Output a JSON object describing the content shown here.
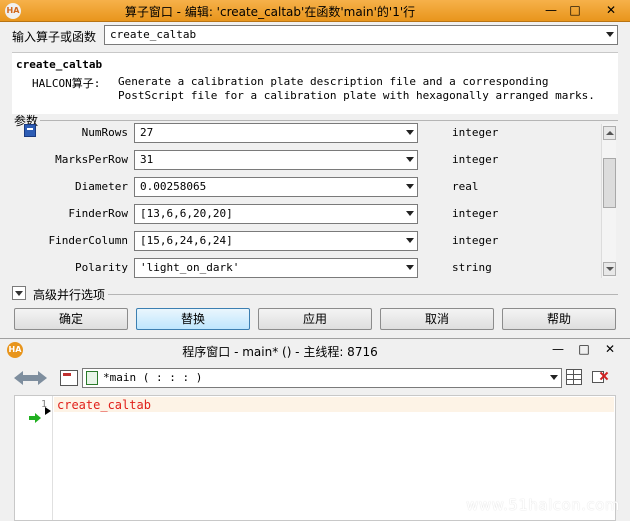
{
  "operator_window": {
    "title": "算子窗口 - 编辑: 'create_caltab'在函数'main'的'1'行",
    "input_label": "输入算子或函数",
    "input_value": "create_caltab",
    "desc": {
      "name": "create_caltab",
      "label": "HALCON算子:",
      "text": "Generate a calibration plate description file and a corresponding PostScript file for a calibration plate with hexagonally arranged marks."
    },
    "params_header": "参数",
    "params": [
      {
        "name": "NumRows",
        "value": "27",
        "type": "integer"
      },
      {
        "name": "MarksPerRow",
        "value": "31",
        "type": "integer"
      },
      {
        "name": "Diameter",
        "value": "0.00258065",
        "type": "real"
      },
      {
        "name": "FinderRow",
        "value": "[13,6,6,20,20]",
        "type": "integer"
      },
      {
        "name": "FinderColumn",
        "value": "[15,6,24,6,24]",
        "type": "integer"
      },
      {
        "name": "Polarity",
        "value": "'light_on_dark'",
        "type": "string"
      }
    ],
    "advanced_label": "高级并行选项",
    "buttons": {
      "ok": "确定",
      "replace": "替换",
      "apply": "应用",
      "cancel": "取消",
      "help": "帮助"
    },
    "window_controls": {
      "minimize": "—",
      "maximize": "□",
      "close": "✕"
    }
  },
  "program_window": {
    "title": "程序窗口 - main* () - 主线程: 8716",
    "procedure_select": "*main ( : : : )",
    "line_number": "1",
    "code_line": "create_caltab",
    "window_controls": {
      "minimize": "—",
      "maximize": "□",
      "close": "✕"
    }
  },
  "app_icon_text": "HA",
  "watermark": "www.51halcon.com"
}
